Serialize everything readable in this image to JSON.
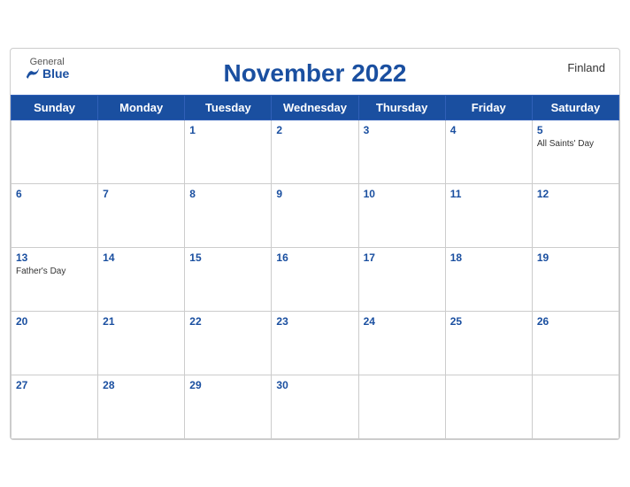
{
  "header": {
    "title": "November 2022",
    "country": "Finland",
    "logo": {
      "general": "General",
      "blue": "Blue"
    }
  },
  "weekdays": [
    "Sunday",
    "Monday",
    "Tuesday",
    "Wednesday",
    "Thursday",
    "Friday",
    "Saturday"
  ],
  "weeks": [
    [
      {
        "day": "",
        "event": ""
      },
      {
        "day": "",
        "event": ""
      },
      {
        "day": "1",
        "event": ""
      },
      {
        "day": "2",
        "event": ""
      },
      {
        "day": "3",
        "event": ""
      },
      {
        "day": "4",
        "event": ""
      },
      {
        "day": "5",
        "event": "All Saints' Day"
      }
    ],
    [
      {
        "day": "6",
        "event": ""
      },
      {
        "day": "7",
        "event": ""
      },
      {
        "day": "8",
        "event": ""
      },
      {
        "day": "9",
        "event": ""
      },
      {
        "day": "10",
        "event": ""
      },
      {
        "day": "11",
        "event": ""
      },
      {
        "day": "12",
        "event": ""
      }
    ],
    [
      {
        "day": "13",
        "event": "Father's Day"
      },
      {
        "day": "14",
        "event": ""
      },
      {
        "day": "15",
        "event": ""
      },
      {
        "day": "16",
        "event": ""
      },
      {
        "day": "17",
        "event": ""
      },
      {
        "day": "18",
        "event": ""
      },
      {
        "day": "19",
        "event": ""
      }
    ],
    [
      {
        "day": "20",
        "event": ""
      },
      {
        "day": "21",
        "event": ""
      },
      {
        "day": "22",
        "event": ""
      },
      {
        "day": "23",
        "event": ""
      },
      {
        "day": "24",
        "event": ""
      },
      {
        "day": "25",
        "event": ""
      },
      {
        "day": "26",
        "event": ""
      }
    ],
    [
      {
        "day": "27",
        "event": ""
      },
      {
        "day": "28",
        "event": ""
      },
      {
        "day": "29",
        "event": ""
      },
      {
        "day": "30",
        "event": ""
      },
      {
        "day": "",
        "event": ""
      },
      {
        "day": "",
        "event": ""
      },
      {
        "day": "",
        "event": ""
      }
    ]
  ]
}
